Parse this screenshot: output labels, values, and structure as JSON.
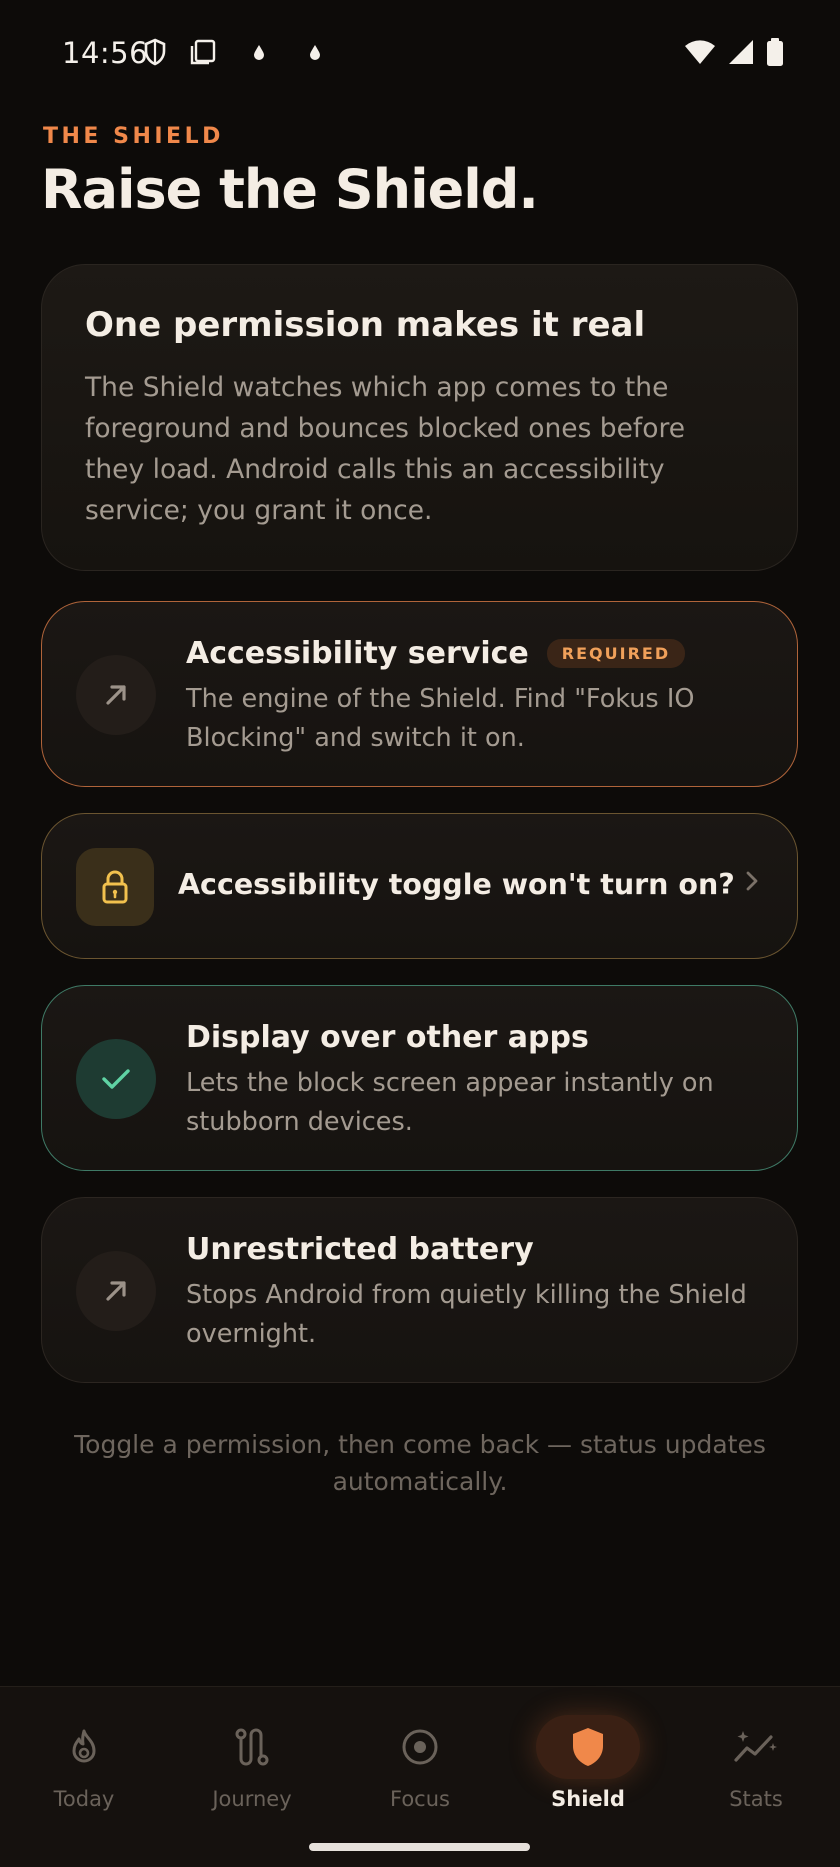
{
  "status_bar": {
    "time": "14:56",
    "left_icons": [
      "shield-icon",
      "screenshot-icon",
      "drop-icon",
      "drop-icon"
    ],
    "right_icons": [
      "wifi-icon",
      "cellular-signal-icon",
      "battery-icon"
    ]
  },
  "header": {
    "eyebrow": "THE SHIELD",
    "title": "Raise the Shield."
  },
  "intro": {
    "title": "One permission makes it real",
    "body": "The Shield watches which app comes to the foreground and bounces blocked ones before they load. Android calls this an accessibility service; you grant it once."
  },
  "permissions": [
    {
      "title": "Accessibility service",
      "badge": "REQUIRED",
      "description": "The engine of the Shield. Find \"Fokus IO Blocking\" and switch it on.",
      "status": "required",
      "icon": "arrow-up-right-icon"
    },
    {
      "title": "Display over other apps",
      "description": "Lets the block screen appear instantly on stubborn devices.",
      "status": "granted",
      "icon": "check-icon"
    },
    {
      "title": "Unrestricted battery",
      "description": "Stops Android from quietly killing the Shield overnight.",
      "status": "pending",
      "icon": "arrow-up-right-icon"
    }
  ],
  "help": {
    "title": "Accessibility toggle won't turn on?",
    "icon": "lock-icon"
  },
  "footer_note": "Toggle a permission, then come back — status updates automatically.",
  "nav": {
    "items": [
      {
        "label": "Today",
        "icon": "flame-icon",
        "active": false
      },
      {
        "label": "Journey",
        "icon": "route-icon",
        "active": false
      },
      {
        "label": "Focus",
        "icon": "target-icon",
        "active": false
      },
      {
        "label": "Shield",
        "icon": "shield-icon",
        "active": true
      },
      {
        "label": "Stats",
        "icon": "sparkle-chart-icon",
        "active": false
      }
    ]
  },
  "colors": {
    "accent": "#f0884a",
    "background": "#0d0b09",
    "granted": "#5fd3a4",
    "warning": "#f2c14e"
  }
}
